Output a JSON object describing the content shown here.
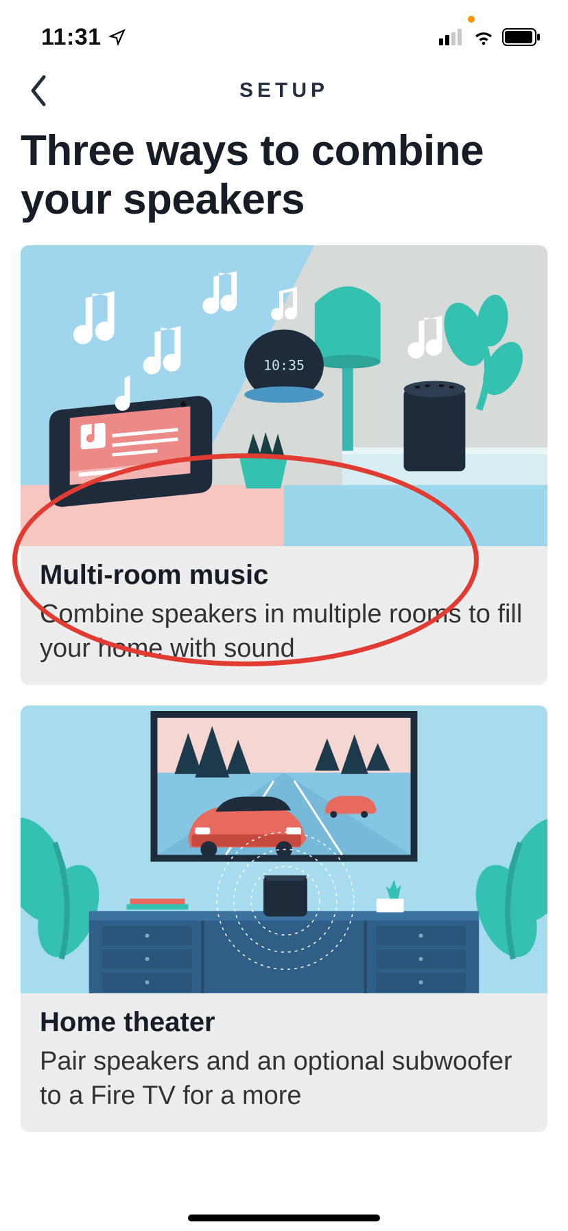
{
  "status": {
    "time": "11:31"
  },
  "header": {
    "title": "SETUP"
  },
  "page": {
    "title": "Three ways to combine your speakers"
  },
  "cards": [
    {
      "clock_time": "10:35",
      "title": "Multi-room music",
      "description": "Combine speakers in multiple rooms to fill your home with sound"
    },
    {
      "title": "Home theater",
      "description": "Pair speakers and an optional subwoofer to a Fire TV for a more"
    }
  ]
}
